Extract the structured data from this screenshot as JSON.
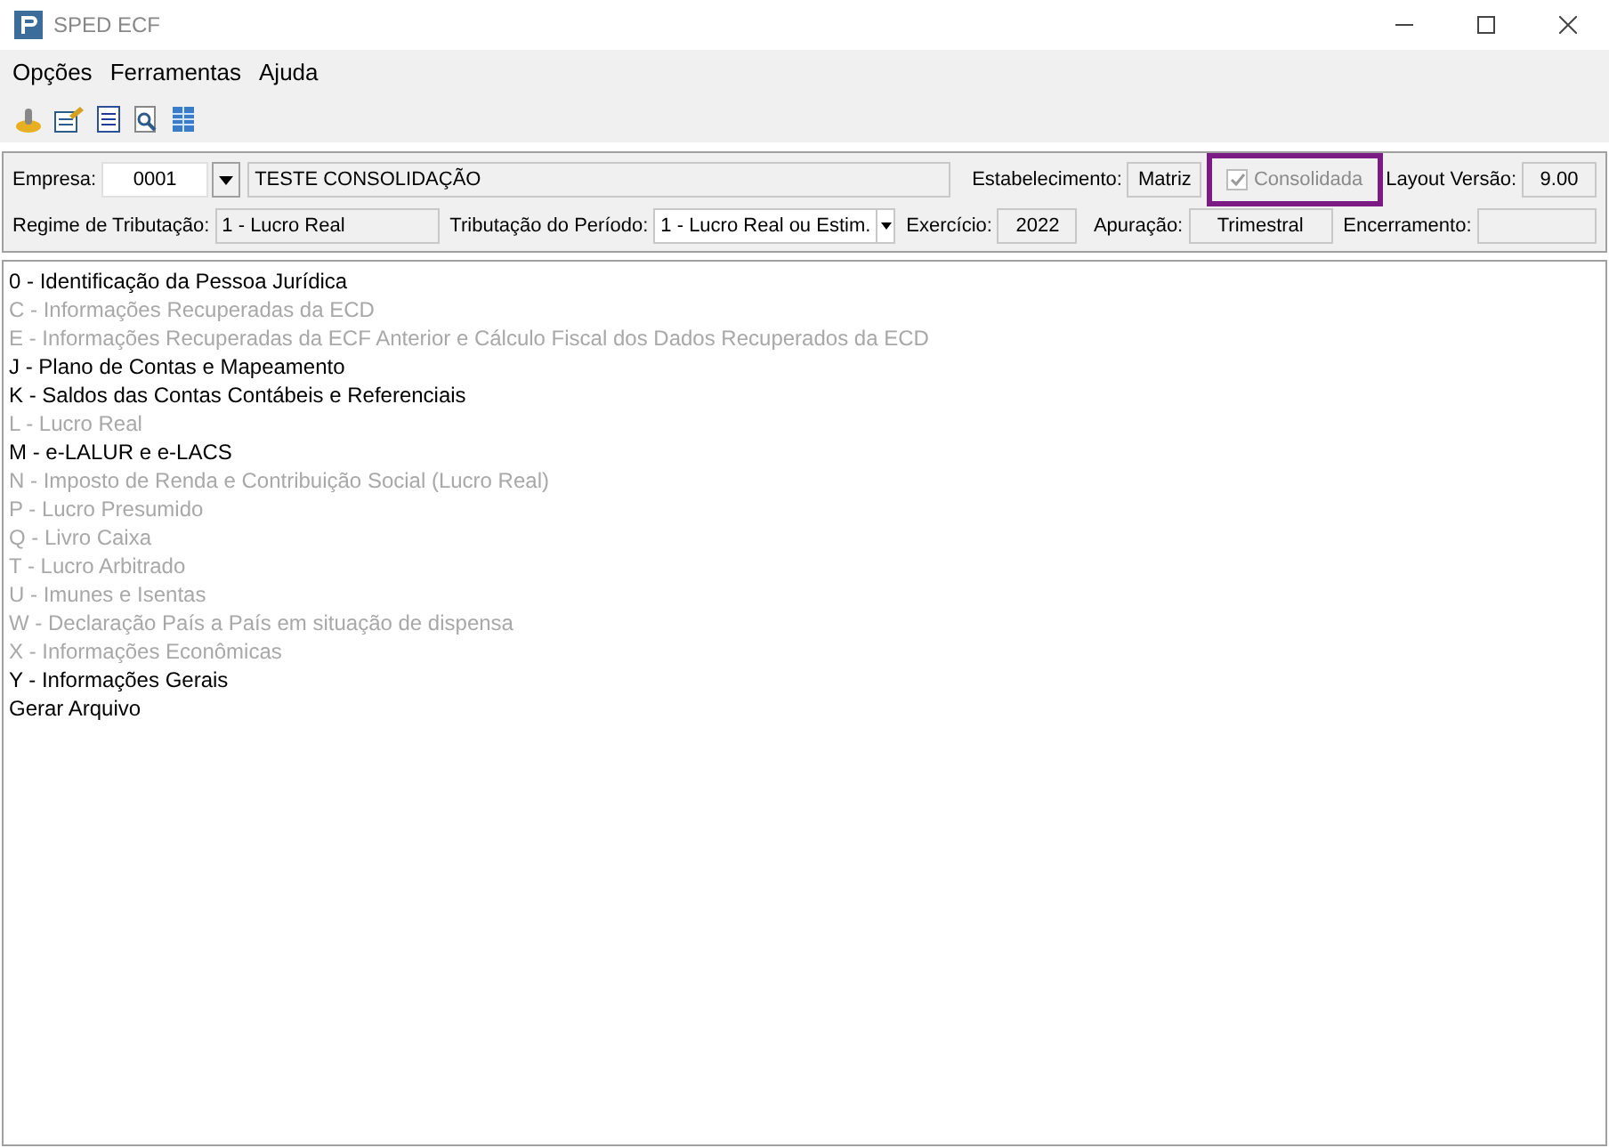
{
  "window": {
    "title": "SPED ECF"
  },
  "menu": [
    "Opções",
    "Ferramentas",
    "Ajuda"
  ],
  "header": {
    "empresa_label": "Empresa:",
    "empresa_code": "0001",
    "empresa_name": "TESTE CONSOLIDAÇÃO",
    "estabelecimento_label": "Estabelecimento:",
    "estabelecimento": "Matriz",
    "consolidada": {
      "label": "Consolidada",
      "checked": true,
      "disabled": true,
      "highlighted": true
    },
    "layout_label": "Layout Versão:",
    "layout": "9.00",
    "regime_label": "Regime de Tributação:",
    "regime": "1 - Lucro Real",
    "periodo_label": "Tributação do Período:",
    "periodo": "1 - Lucro Real ou Estim.",
    "exercicio_label": "Exercício:",
    "exercicio": "2022",
    "apuracao_label": "Apuração:",
    "apuracao": "Trimestral",
    "encerramento_label": "Encerramento:"
  },
  "blocks": [
    {
      "label": "0 - Identificação da Pessoa Jurídica",
      "disabled": false
    },
    {
      "label": "C - Informações Recuperadas da ECD",
      "disabled": true
    },
    {
      "label": "E - Informações Recuperadas da ECF Anterior e Cálculo Fiscal dos Dados Recuperados da ECD",
      "disabled": true
    },
    {
      "label": "J - Plano de Contas e Mapeamento",
      "disabled": false
    },
    {
      "label": "K - Saldos das Contas Contábeis e Referenciais",
      "disabled": false
    },
    {
      "label": "L - Lucro Real",
      "disabled": true
    },
    {
      "label": "M - e-LALUR e e-LACS",
      "disabled": false
    },
    {
      "label": "N - Imposto de Renda e Contribuição Social (Lucro Real)",
      "disabled": true
    },
    {
      "label": "P - Lucro Presumido",
      "disabled": true
    },
    {
      "label": "Q - Livro Caixa",
      "disabled": true
    },
    {
      "label": "T - Lucro Arbitrado",
      "disabled": true
    },
    {
      "label": "U - Imunes e Isentas",
      "disabled": true
    },
    {
      "label": "W - Declaração País a País em situação de dispensa",
      "disabled": true
    },
    {
      "label": "X - Informações Econômicas",
      "disabled": true
    },
    {
      "label": "Y - Informações Gerais",
      "disabled": false
    },
    {
      "label": "Gerar Arquivo",
      "disabled": false
    }
  ]
}
